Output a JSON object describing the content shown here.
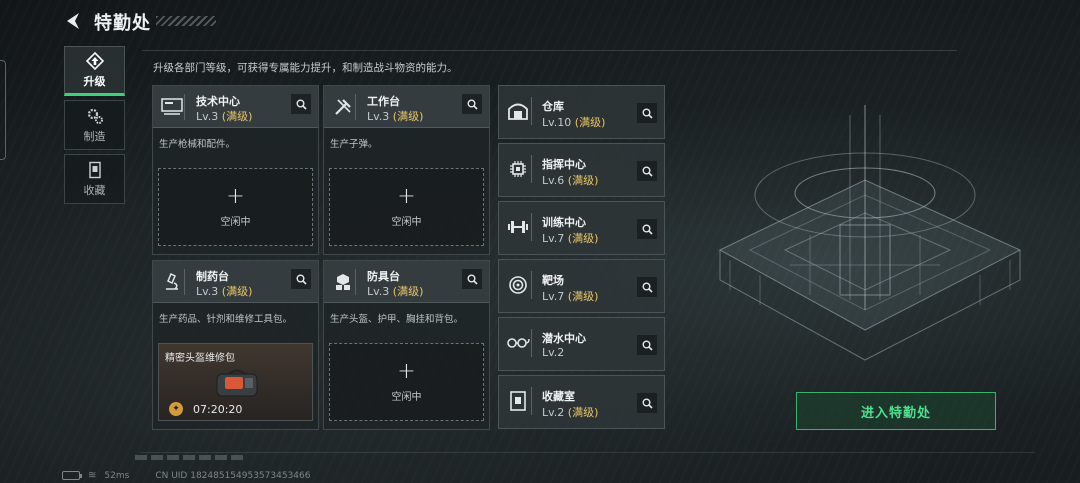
{
  "header": {
    "title": "特勤处"
  },
  "tabs": [
    {
      "label": "升级",
      "icon": "upgrade-icon",
      "active": true
    },
    {
      "label": "制造",
      "icon": "gears-icon",
      "active": false
    },
    {
      "label": "收藏",
      "icon": "collection-icon",
      "active": false
    }
  ],
  "description": "升级各部门等级，可获得专属能力提升，和制造战斗物资的能力。",
  "facilities": [
    {
      "name": "技术中心",
      "level": "Lv.3",
      "max": "(满级)",
      "desc": "生产枪械和配件。",
      "icon": "computer-icon",
      "slot": {
        "plus": "+",
        "status": "空闲中"
      }
    },
    {
      "name": "工作台",
      "level": "Lv.3",
      "max": "(满级)",
      "desc": "生产子弹。",
      "icon": "tools-icon",
      "slot": {
        "plus": "+",
        "status": "空闲中"
      }
    },
    {
      "name": "制药台",
      "level": "Lv.3",
      "max": "(满级)",
      "desc": "生产药品、针剂和维修工具包。",
      "icon": "microscope-icon",
      "slot": {
        "item_name": "精密头盔维修包",
        "timer": "07:20:20"
      }
    },
    {
      "name": "防具台",
      "level": "Lv.3",
      "max": "(满级)",
      "desc": "生产头盔、护甲、胸挂和背包。",
      "icon": "armor-icon",
      "slot": {
        "plus": "+",
        "status": "空闲中"
      }
    }
  ],
  "list": [
    {
      "name": "仓库",
      "level": "Lv.10",
      "max": "(满级)",
      "icon": "warehouse-icon"
    },
    {
      "name": "指挥中心",
      "level": "Lv.6",
      "max": "(满级)",
      "icon": "chip-icon"
    },
    {
      "name": "训练中心",
      "level": "Lv.7",
      "max": "(满级)",
      "icon": "dumbbell-icon"
    },
    {
      "name": "靶场",
      "level": "Lv.7",
      "max": "(满级)",
      "icon": "target-icon"
    },
    {
      "name": "潜水中心",
      "level": "Lv.2",
      "max": "",
      "icon": "diving-icon"
    },
    {
      "name": "收藏室",
      "level": "Lv.2",
      "max": "(满级)",
      "icon": "collection-room-icon"
    }
  ],
  "enter_button": "进入特勤处",
  "footer": {
    "ping": "52ms",
    "uid": "CN UID 1824851549535734​53466"
  },
  "colors": {
    "accent_green": "#3fd07a",
    "max_level": "#e9c46a"
  }
}
